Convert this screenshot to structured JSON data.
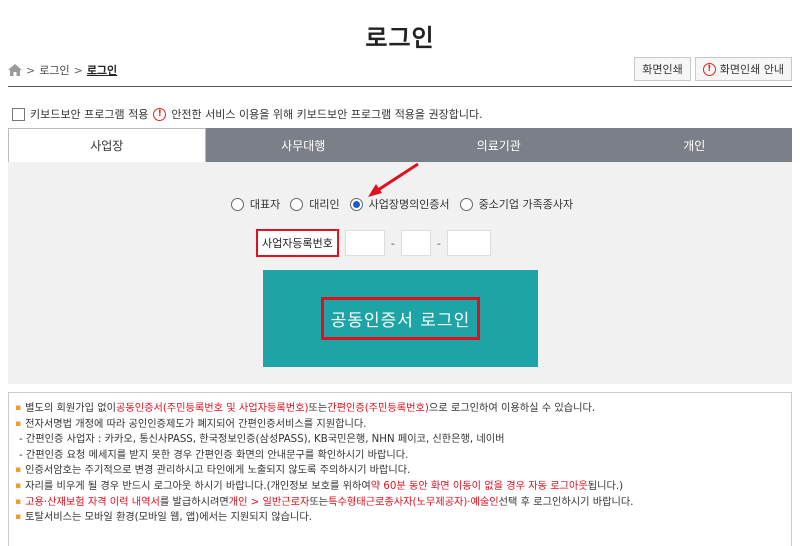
{
  "page_title": "로그인",
  "breadcrumb": {
    "items": [
      "로그인",
      "로그인"
    ],
    "separator": ">"
  },
  "top_buttons": {
    "print": "화면인쇄",
    "print_guide": "화면인쇄 안내"
  },
  "keyboard_security": {
    "label": "키보드보안 프로그램 적용",
    "notice": "안전한 서비스 이용을 위해 키보드보안 프로그램 적용을 권장합니다."
  },
  "tabs": [
    {
      "label": "사업장",
      "active": true
    },
    {
      "label": "사무대행",
      "active": false
    },
    {
      "label": "의료기관",
      "active": false
    },
    {
      "label": "개인",
      "active": false
    }
  ],
  "login_type_options": [
    {
      "label": "대표자",
      "checked": false
    },
    {
      "label": "대리인",
      "checked": false
    },
    {
      "label": "사업장명의인증서",
      "checked": true
    },
    {
      "label": "중소기업 가족종사자",
      "checked": false
    }
  ],
  "business_number": {
    "label": "사업자등록번호",
    "separator": "-"
  },
  "cert_login_label": "공동인증서 로그인",
  "accent_colors": {
    "highlight_red": "#e0101e",
    "button_teal": "#1ea3a7",
    "tab_gray": "#7b7f87",
    "bullet_orange": "#f09c2c"
  },
  "info": {
    "l1a": "별도의 회원가입 없이 ",
    "l1b": "공동인증서(주민등록번호 및 사업자등록번호)",
    "l1c": " 또는 ",
    "l1d": "간편인증(주민등록번호)",
    "l1e": "으로 로그인하여 이용하실 수 있습니다.",
    "l2": "전자서명법 개정에 따라 공인인증제도가 폐지되어 간편인증서비스를 지원합니다.",
    "l3": "- 간편인증 사업자 : 카카오, 통신사PASS, 한국정보인증(삼성PASS), KB국민은행, NHN 페이코, 신한은행, 네이버",
    "l4": "- 간편인증 요청 메세지를 받지 못한 경우 간편인증 화면의 안내문구를 확인하시기 바랍니다.",
    "l5": "인증서암호는 주기적으로 변경 관리하시고 타인에게 노출되지 않도록 주의하시기 바랍니다.",
    "l6a": "자리를 비우게 될 경우 반드시 로그아웃 하시기 바랍니다.(개인정보 보호를 위하여 ",
    "l6b": "약 60분 동안 화면 이동이 없을 경우 자동 로그아웃",
    "l6c": "됩니다.)",
    "l7a": "고용·산재보험 자격 이력 내역서",
    "l7b": "를 발급하시려면 ",
    "l7c": "개인 > 일반근로자",
    "l7d": " 또는 ",
    "l7e": "특수형태근로종사자(노무제공자)·예술인",
    "l7f": " 선택 후 로그인하시기 바랍니다.",
    "l8": "토탈서비스는 모바일 환경(모바일 웹, 앱)에서는 지원되지 않습니다."
  }
}
